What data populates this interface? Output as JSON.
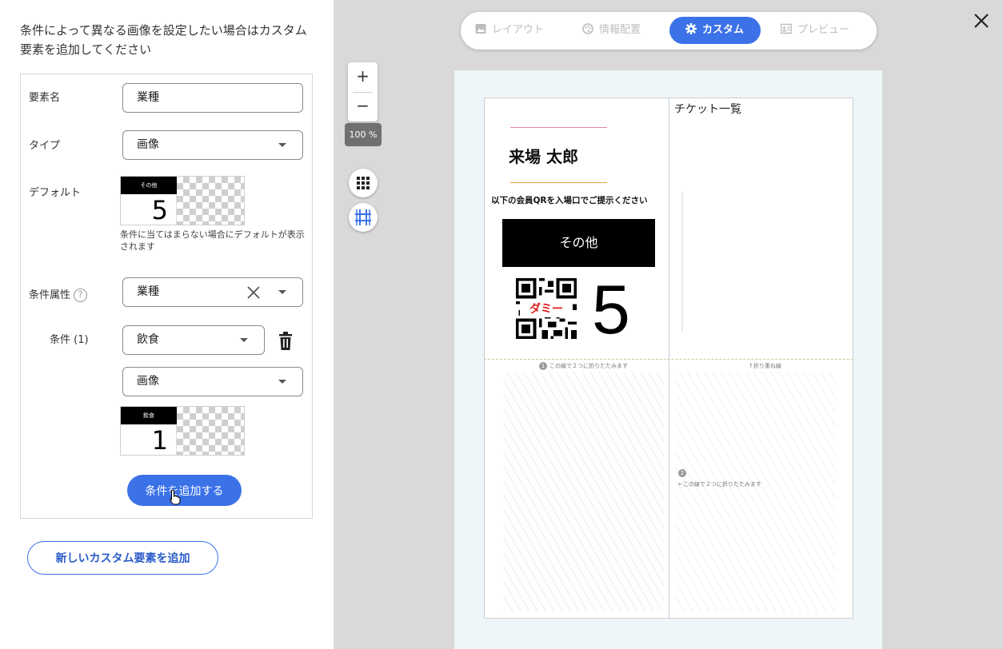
{
  "left_panel": {
    "intro": "条件によって異なる画像を設定したい場合はカスタム要素を追加してください",
    "element_name_label": "要素名",
    "element_name_value": "業種",
    "type_label": "タイプ",
    "type_value": "画像",
    "default_label": "デフォルト",
    "default_thumb": {
      "bar_text": "その他",
      "number": "5"
    },
    "default_hint": "条件に当てはまらない場合にデフォルトが表示されます",
    "cond_attr_label": "条件属性",
    "cond_attr_help": "?",
    "cond_attr_value": "業種",
    "condition_label": "条件 (1)",
    "condition_value": "飲食",
    "condition_type_value": "画像",
    "condition_thumb": {
      "bar_text": "飲食",
      "number": "1"
    },
    "add_condition_button": "条件を追加する",
    "add_custom_button": "新しいカスタム要素を追加"
  },
  "tabs": [
    {
      "label": "レイアウト",
      "icon": "image-icon"
    },
    {
      "label": "情報配置",
      "icon": "palette-icon"
    },
    {
      "label": "カスタム",
      "icon": "gear-icon",
      "active": true
    },
    {
      "label": "プレビュー",
      "icon": "id-card-icon"
    }
  ],
  "zoom": {
    "plus": "+",
    "minus": "−",
    "level": "100 %"
  },
  "preview": {
    "ticket_list": "チケット一覧",
    "name": "来場 太郎",
    "qr_instruction": "以下の会員QRを入場口でご提示ください",
    "category": "その他",
    "dummy": "ダミー",
    "number": "5",
    "fold1": "この線で２つに折りたたみます",
    "fold1_num": "1",
    "fold2": "↑折り重ね線",
    "fold3": "←この線で２つに折りたたみます",
    "fold3_num": "2"
  },
  "colors": {
    "accent": "#3b72e8"
  }
}
